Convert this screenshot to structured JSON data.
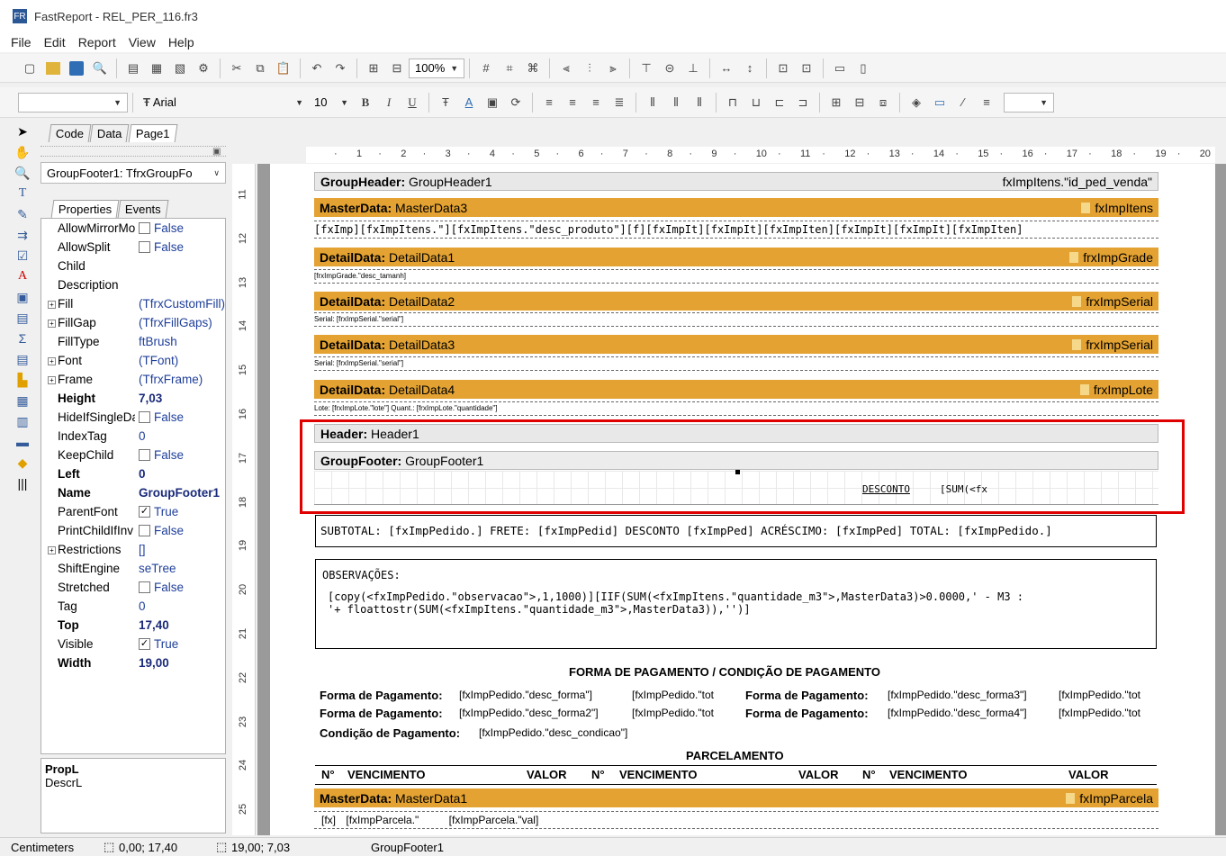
{
  "window": {
    "title": "FastReport - REL_PER_116.fr3"
  },
  "menu": [
    "File",
    "Edit",
    "Report",
    "View",
    "Help"
  ],
  "toolbar": {
    "zoom": "100%"
  },
  "fontbar": {
    "style_combo": "",
    "font_name": "Arial",
    "font_size": "10",
    "bold": "B",
    "italic": "I",
    "underline": "U"
  },
  "tabs": [
    "Code",
    "Data",
    "Page1"
  ],
  "inspector": {
    "object": "GroupFooter1: TfrxGroupFo",
    "tabs": [
      "Properties",
      "Events"
    ],
    "props": [
      {
        "name": "AllowMirrorMo",
        "value": "False",
        "check": ""
      },
      {
        "name": "AllowSplit",
        "value": "False",
        "check": ""
      },
      {
        "name": "Child",
        "value": ""
      },
      {
        "name": "Description",
        "value": ""
      },
      {
        "name": "Fill",
        "value": "(TfrxCustomFill)",
        "expand": "+"
      },
      {
        "name": "FillGap",
        "value": "(TfrxFillGaps)",
        "expand": "+"
      },
      {
        "name": "FillType",
        "value": "ftBrush"
      },
      {
        "name": "Font",
        "value": "(TFont)",
        "expand": "+"
      },
      {
        "name": "Frame",
        "value": "(TfrxFrame)",
        "expand": "+"
      },
      {
        "name": "Height",
        "value": "7,03",
        "bold": true
      },
      {
        "name": "HideIfSingleDa",
        "value": "False",
        "check": ""
      },
      {
        "name": "IndexTag",
        "value": "0"
      },
      {
        "name": "KeepChild",
        "value": "False",
        "check": ""
      },
      {
        "name": "Left",
        "value": "0",
        "bold": true
      },
      {
        "name": "Name",
        "value": "GroupFooter1",
        "bold": true
      },
      {
        "name": "ParentFont",
        "value": "True",
        "check": "✓"
      },
      {
        "name": "PrintChildIfInv",
        "value": "False",
        "check": ""
      },
      {
        "name": "Restrictions",
        "value": "[]",
        "expand": "+"
      },
      {
        "name": "ShiftEngine",
        "value": "seTree"
      },
      {
        "name": "Stretched",
        "value": "False",
        "check": ""
      },
      {
        "name": "Tag",
        "value": "0"
      },
      {
        "name": "Top",
        "value": "17,40",
        "bold": true
      },
      {
        "name": "Visible",
        "value": "True",
        "check": "✓"
      },
      {
        "name": "Width",
        "value": "19,00",
        "bold": true
      }
    ],
    "desc_title": "PropL",
    "desc_text": "DescrL"
  },
  "ruler_h": [
    "1",
    "2",
    "3",
    "4",
    "5",
    "6",
    "7",
    "8",
    "9",
    "10",
    "11",
    "12",
    "13",
    "14",
    "15",
    "16",
    "17",
    "18",
    "19",
    "20"
  ],
  "ruler_v": [
    "11",
    "12",
    "13",
    "14",
    "15",
    "16",
    "17",
    "18",
    "19",
    "20",
    "21",
    "22",
    "23",
    "24",
    "25"
  ],
  "bands": {
    "gh": {
      "type": "GroupHeader:",
      "name": "GroupHeader1",
      "source": "fxImpItens.\"id_ped_venda\""
    },
    "md3": {
      "type": "MasterData:",
      "name": "MasterData3",
      "source": "fxImpItens"
    },
    "dd1": {
      "type": "DetailData:",
      "name": "DetailData1",
      "source": "frxImpGrade"
    },
    "dd2": {
      "type": "DetailData:",
      "name": "DetailData2",
      "source": "frxImpSerial"
    },
    "dd3": {
      "type": "DetailData:",
      "name": "DetailData3",
      "source": "frxImpSerial"
    },
    "dd4": {
      "type": "DetailData:",
      "name": "DetailData4",
      "source": "frxImpLote"
    },
    "hdr": {
      "type": "Header:",
      "name": "Header1"
    },
    "gf": {
      "type": "GroupFooter:",
      "name": "GroupFooter1"
    },
    "md1": {
      "type": "MasterData:",
      "name": "MasterData1",
      "source": "fxImpParcela"
    }
  },
  "report": {
    "md3_row": "[fxImp][fxImpItens.\"][fxImpItens.\"desc_produto\"][f][fxImpIt][fxImpIt][fxImpIten][fxImpIt][fxImpIt][fxImpIten]",
    "dd1_row": "[frxImpGrade.\"desc_tamanh]",
    "dd2_row": "Serial: [frxImpSerial.\"serial\"]",
    "dd3_row": "Serial: [frxImpSerial.\"serial\"]",
    "dd4_row": "Lote: [frxImpLote.\"lote\"] Quant.: [frxImpLote.\"quantidade\"]",
    "gf_desconto": "DESCONTO",
    "gf_sum": "[SUM(<fx",
    "totals": "SUBTOTAL: [fxImpPedido.] FRETE: [fxImpPedid] DESCONTO [fxImpPed] ACRÉSCIMO: [fxImpPed] TOTAL: [fxImpPedido.]",
    "obs_label": "OBSERVAÇÕES:",
    "obs_line1": "[copy(<fxImpPedido.\"observacao\">,1,1000)][IIF(SUM(<fxImpItens.\"quantidade_m3\">,MasterData3)>0.0000,' - M3 :",
    "obs_line2": "'+ floattostr(SUM(<fxImpItens.\"quantidade_m3\">,MasterData3)),'')]",
    "pay_title": "FORMA DE PAGAMENTO / CONDIÇÃO DE PAGAMENTO",
    "pay_label": "Forma de Pagamento:",
    "pay_f1": "[fxImpPedido.\"desc_forma\"]",
    "pay_f2": "[fxImpPedido.\"desc_forma2\"]",
    "pay_f3": "[fxImpPedido.\"desc_forma3\"]",
    "pay_f4": "[fxImpPedido.\"desc_forma4\"]",
    "pay_tot": "[fxImpPedido.\"tot",
    "cond_label": "Condição de Pagamento:",
    "cond_value": "[fxImpPedido.\"desc_condicao\"]",
    "parc_title": "PARCELAMENTO",
    "parc_no": "N°",
    "parc_venc": "VENCIMENTO",
    "parc_valor": "VALOR",
    "md1_row1": "[fx]",
    "md1_row2": "[fxImpParcela.\"",
    "md1_row3": "[fxImpParcela.\"val]"
  },
  "status": {
    "units": "Centimeters",
    "pos": "0,00; 17,40",
    "size": "19,00; 7,03",
    "object": "GroupFooter1"
  }
}
